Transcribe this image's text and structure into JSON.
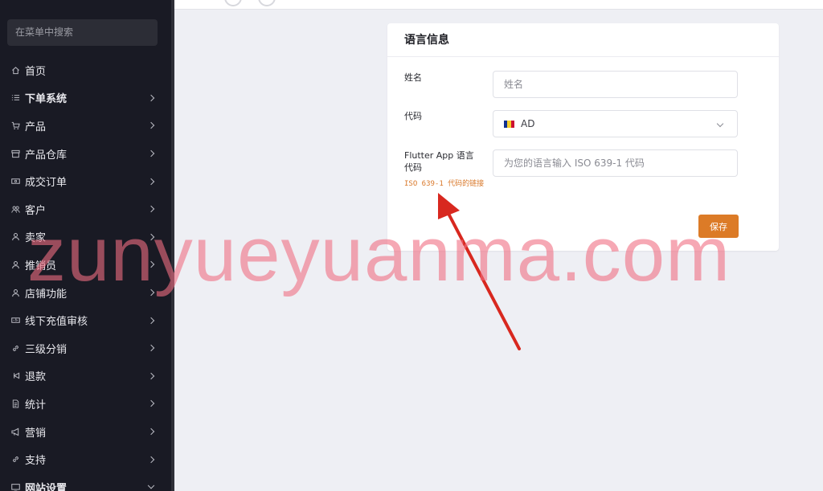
{
  "sidebar": {
    "search_placeholder": "在菜单中搜索",
    "items": [
      {
        "label": "首页",
        "icon": "home-icon",
        "has_children": false
      },
      {
        "label": "下单系统",
        "icon": "list-icon",
        "has_children": true,
        "selected": true
      },
      {
        "label": "产品",
        "icon": "cart-icon",
        "has_children": true
      },
      {
        "label": "产品仓库",
        "icon": "archive-icon",
        "has_children": true
      },
      {
        "label": "成交订单",
        "icon": "ticket-icon",
        "has_children": true
      },
      {
        "label": "客户",
        "icon": "users-icon",
        "has_children": true
      },
      {
        "label": "卖家",
        "icon": "user-icon",
        "has_children": true
      },
      {
        "label": "推销员",
        "icon": "user-icon",
        "has_children": true
      },
      {
        "label": "店铺功能",
        "icon": "user-icon",
        "has_children": true
      },
      {
        "label": "线下充值审核",
        "icon": "money-icon",
        "has_children": true
      },
      {
        "label": "三级分销",
        "icon": "link-icon",
        "has_children": true
      },
      {
        "label": "退款",
        "icon": "undo-icon",
        "has_children": true
      },
      {
        "label": "统计",
        "icon": "document-icon",
        "has_children": true
      },
      {
        "label": "营销",
        "icon": "megaphone-icon",
        "has_children": true
      },
      {
        "label": "支持",
        "icon": "link-icon",
        "has_children": true
      },
      {
        "label": "网站设置",
        "icon": "monitor-icon",
        "has_children": true,
        "expanded": true
      }
    ]
  },
  "card": {
    "title": "语言信息",
    "name_label": "姓名",
    "name_placeholder": "姓名",
    "code_label": "代码",
    "code_value": "AD",
    "flutter_label": "Flutter App 语言代码",
    "flutter_placeholder": "为您的语言输入 ISO 639-1 代码",
    "hint_text": "ISO 639-1 代码的链接",
    "save_label": "保存"
  },
  "watermark": "zunyueyuanma.com",
  "colors": {
    "sidebar_bg": "#191a24",
    "accent": "#dc7b27",
    "hint": "#d9782a",
    "arrow": "#d8281f",
    "watermark": "#f06e82"
  }
}
